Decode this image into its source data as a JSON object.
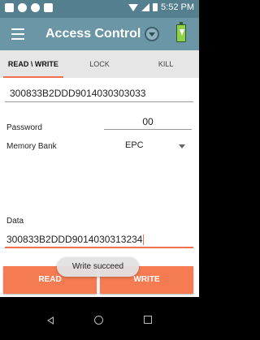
{
  "status_bar": {
    "time": "5:52 PM",
    "left_icons": [
      "notification-icon",
      "messenger-icon",
      "skype-icon",
      "app-icon"
    ],
    "right_icons": [
      "wifi-icon",
      "signal-icon",
      "battery-icon"
    ]
  },
  "app_bar": {
    "title": "Access Control",
    "menu_icon": "menu-icon",
    "dropdown_icon": "chevron-down-icon",
    "battery_icon": "battery-charging-icon"
  },
  "tabs": [
    {
      "label": "READ \\ WRITE",
      "active": true
    },
    {
      "label": "LOCK",
      "active": false
    },
    {
      "label": "KILL",
      "active": false
    }
  ],
  "form": {
    "epc_value": "300833B2DDD9014030303033",
    "password_label": "Password",
    "password_value": "00",
    "memory_bank_label": "Memory Bank",
    "memory_bank_value": "EPC",
    "data_label": "Data",
    "data_value": "300833B2DDD9014030313234"
  },
  "buttons": {
    "read_label": "READ",
    "write_label": "WRITE"
  },
  "toast": {
    "message": "Write succeed"
  },
  "colors": {
    "status_bar": "#547f8e",
    "app_bar": "#6a96a6",
    "accent": "#f57c52",
    "tab_bar": "#e6e6e6"
  }
}
